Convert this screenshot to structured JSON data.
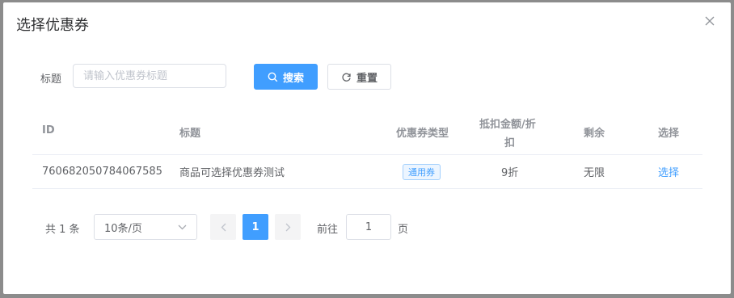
{
  "dialog": {
    "title": "选择优惠券"
  },
  "filter": {
    "label": "标题",
    "placeholder": "请输入优惠券标题",
    "search_label": "搜索",
    "reset_label": "重置"
  },
  "table": {
    "headers": {
      "id": "ID",
      "title": "标题",
      "type": "优惠券类型",
      "amount_line1": "抵扣金额/折",
      "amount_line2": "扣",
      "remaining": "剩余",
      "select": "选择"
    },
    "rows": [
      {
        "id": "760682050784067585",
        "title": "商品可选择优惠券测试",
        "type": "通用券",
        "amount": "9折",
        "remaining": "无限",
        "action": "选择"
      }
    ]
  },
  "pagination": {
    "total_text": "共 1 条",
    "page_size": "10条/页",
    "current_page": "1",
    "goto_prefix": "前往",
    "goto_value": "1",
    "goto_suffix": "页"
  },
  "colors": {
    "accent": "#409eff",
    "overlay": "#8c8c8c"
  }
}
